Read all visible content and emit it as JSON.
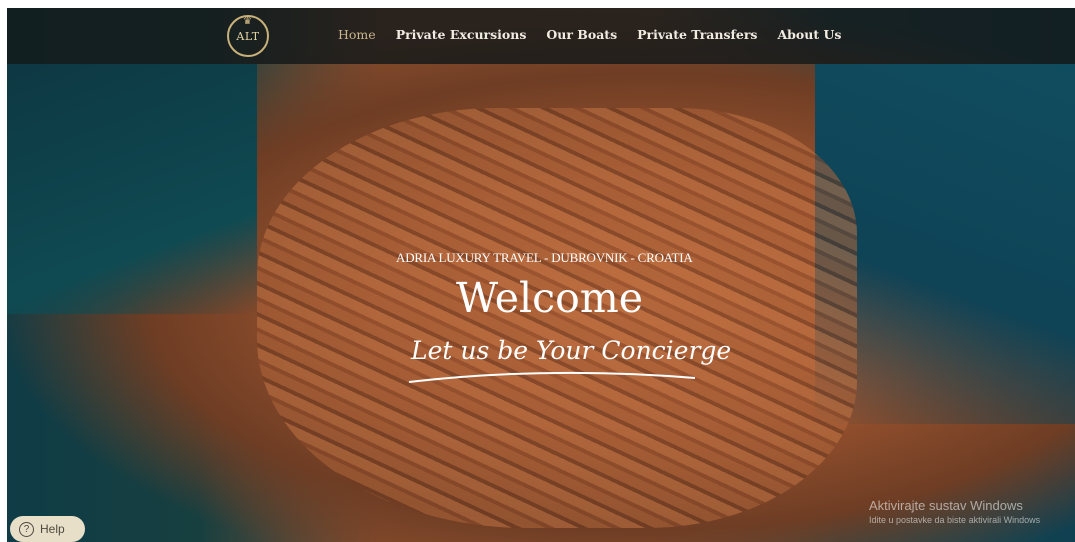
{
  "navbar": {
    "logo_text": "ALT",
    "items": [
      {
        "label": "Home",
        "active": true
      },
      {
        "label": "Private Excursions"
      },
      {
        "label": "Our Boats"
      },
      {
        "label": "Private Transfers"
      },
      {
        "label": "About Us"
      }
    ]
  },
  "hero": {
    "tagline": "ADRIA LUXURY TRAVEL - DUBROVNIK - CROATIA",
    "title": "Welcome",
    "subtitle": "Let us be Your Concierge"
  },
  "help": {
    "label": "Help"
  },
  "watermark": {
    "title": "Aktivirajte sustav Windows",
    "subtitle": "Idite u postavke da biste aktivirali Windows"
  },
  "colors": {
    "nav_active": "#c9b58c",
    "nav_text": "#f1ece2",
    "help_bg": "#e8dfc9"
  }
}
